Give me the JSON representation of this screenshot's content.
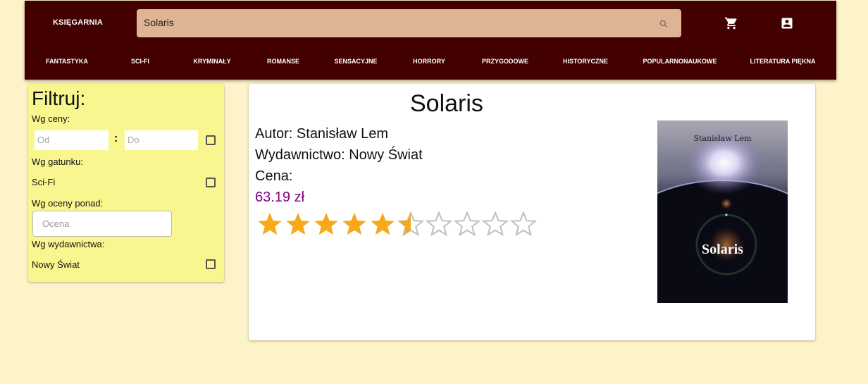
{
  "header": {
    "brand": "KSIĘGARNIA",
    "search_value": "Solaris",
    "icons": {
      "search": "search-icon",
      "cart": "cart-icon",
      "account": "account-icon"
    }
  },
  "nav": {
    "items": [
      {
        "label": "FANTASTYKA"
      },
      {
        "label": "SCI-FI"
      },
      {
        "label": "KRYMINAŁY"
      },
      {
        "label": "ROMANSE"
      },
      {
        "label": "SENSACYJNE"
      },
      {
        "label": "HORRORY"
      },
      {
        "label": "PRZYGODOWE"
      },
      {
        "label": "HISTORYCZNE"
      },
      {
        "label": "POPULARNONAUKOWE"
      },
      {
        "label": "LITERATURA PIĘKNA"
      }
    ]
  },
  "filter": {
    "title": "Filtruj:",
    "price_label": "Wg ceny:",
    "price_from_placeholder": "Od",
    "price_separator": ":",
    "price_to_placeholder": "Do",
    "genre_label": "Wg gatunku:",
    "genre_option": "Sci-Fi",
    "rating_label": "Wg oceny ponad:",
    "rating_placeholder": "Ocena",
    "publisher_label": "Wg wydawnictwa:",
    "publisher_option": "Nowy Świat"
  },
  "book": {
    "title": "Solaris",
    "author_line": "Autor: Stanisław Lem",
    "publisher_line": "Wydawnictwo: Nowy Świat",
    "price_label": "Cena:",
    "price": "63.19 zł",
    "rating": 5.5,
    "rating_max": 10,
    "cover": {
      "author": "Stanisław Lem",
      "title": "Solaris"
    }
  },
  "colors": {
    "background": "#fcf3c8",
    "header": "#420000",
    "search": "#deb494",
    "filter_panel": "#f8f68f",
    "price": "#800080",
    "star_filled": "#f7a918",
    "star_empty": "#c0c0c0"
  }
}
